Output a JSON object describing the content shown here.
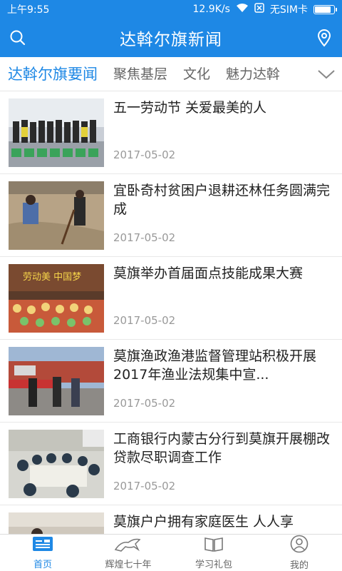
{
  "status_bar": {
    "time": "上午9:55",
    "speed": "12.9K/s",
    "sim": "无SIM卡",
    "battery_level": 0.85
  },
  "header": {
    "title": "达斡尔旗新闻",
    "search_icon": "search-icon",
    "location_icon": "location-pin-icon"
  },
  "tabs": [
    {
      "label": "达斡尔旗要闻",
      "active": true
    },
    {
      "label": "聚焦基层",
      "active": false
    },
    {
      "label": "文化",
      "active": false
    },
    {
      "label": "魅力达斡",
      "active": false
    }
  ],
  "news": [
    {
      "title": "五一劳动节 关爱最美的人",
      "date": "2017-05-02"
    },
    {
      "title": "宜卧奇村贫困户退耕还林任务圆满完成",
      "date": "2017-05-02"
    },
    {
      "title": "莫旗举办首届面点技能成果大赛",
      "date": "2017-05-02"
    },
    {
      "title": "莫旗渔政渔港监督管理站积极开展2017年渔业法规集中宣...",
      "date": "2017-05-02"
    },
    {
      "title": "工商银行内蒙古分行到莫旗开展棚改 贷款尽职调查工作",
      "date": "2017-05-02"
    },
    {
      "title": "莫旗户户拥有家庭医生 人人享",
      "date": ""
    }
  ],
  "thumb_banner_text": "劳动美 中国梦",
  "bottom_nav": [
    {
      "label": "首页",
      "icon": "home-news-icon",
      "active": true
    },
    {
      "label": "辉煌七十年",
      "icon": "horse-icon",
      "active": false
    },
    {
      "label": "学习礼包",
      "icon": "book-icon",
      "active": false
    },
    {
      "label": "我的",
      "icon": "user-icon",
      "active": false
    }
  ],
  "colors": {
    "primary": "#1e88e5",
    "text": "#222222",
    "muted": "#999999"
  }
}
